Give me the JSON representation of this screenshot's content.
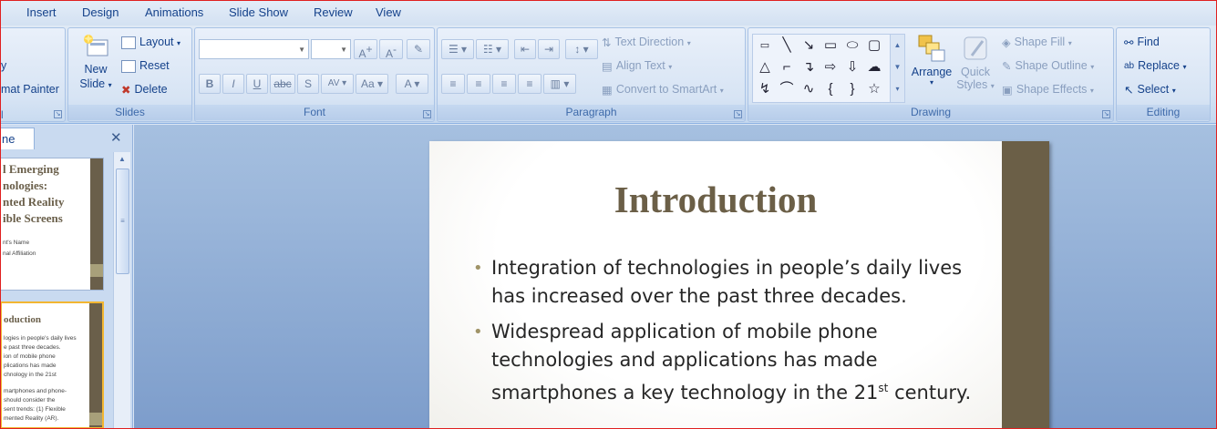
{
  "tabs": [
    "Insert",
    "Design",
    "Animations",
    "Slide Show",
    "Review",
    "View"
  ],
  "clipboard": {
    "partial_top": "y",
    "format_painter": "mat Painter",
    "partial_label": "l"
  },
  "slides_group": {
    "new_slide": "New",
    "new_slide_2": "Slide",
    "layout": "Layout",
    "reset": "Reset",
    "delete": "Delete",
    "label": "Slides"
  },
  "font_group": {
    "label": "Font",
    "font_name": "",
    "font_size": ""
  },
  "paragraph_group": {
    "text_direction": "Text Direction",
    "align_text": "Align Text",
    "convert_smartart": "Convert to SmartArt",
    "label": "Paragraph"
  },
  "drawing_group": {
    "arrange": "Arrange",
    "quick": "Quick",
    "styles": "Styles",
    "shape_fill": "Shape Fill",
    "shape_outline": "Shape Outline",
    "shape_effects": "Shape Effects",
    "label": "Drawing"
  },
  "editing_group": {
    "find": "Find",
    "replace": "Replace",
    "select": "Select",
    "label": "Editing"
  },
  "left_pane": {
    "tab_label": "ne",
    "thumb1": {
      "title": [
        "l Emerging",
        "nologies:",
        "nted Reality",
        "ible Screens"
      ],
      "small": [
        "nt's Name",
        "nal Affiliation"
      ]
    },
    "thumb2": {
      "title": "oduction",
      "lines": [
        "logies in people's daily lives",
        "e past three decades.",
        "ion of mobile phone",
        "plications has made",
        "chnology in the 21st",
        "",
        "martphones and phone-",
        "should consider the",
        "sent trends: (1) Flexible",
        "mented Reality (AR)."
      ]
    }
  },
  "slide": {
    "title": "Introduction",
    "bullets": [
      "Integration of technologies in people’s daily lives has increased over the past three decades.",
      "Widespread application of mobile phone technologies and applications has made smartphones a key technology in the 21"
    ],
    "superscript": "st",
    "tail": "century."
  }
}
